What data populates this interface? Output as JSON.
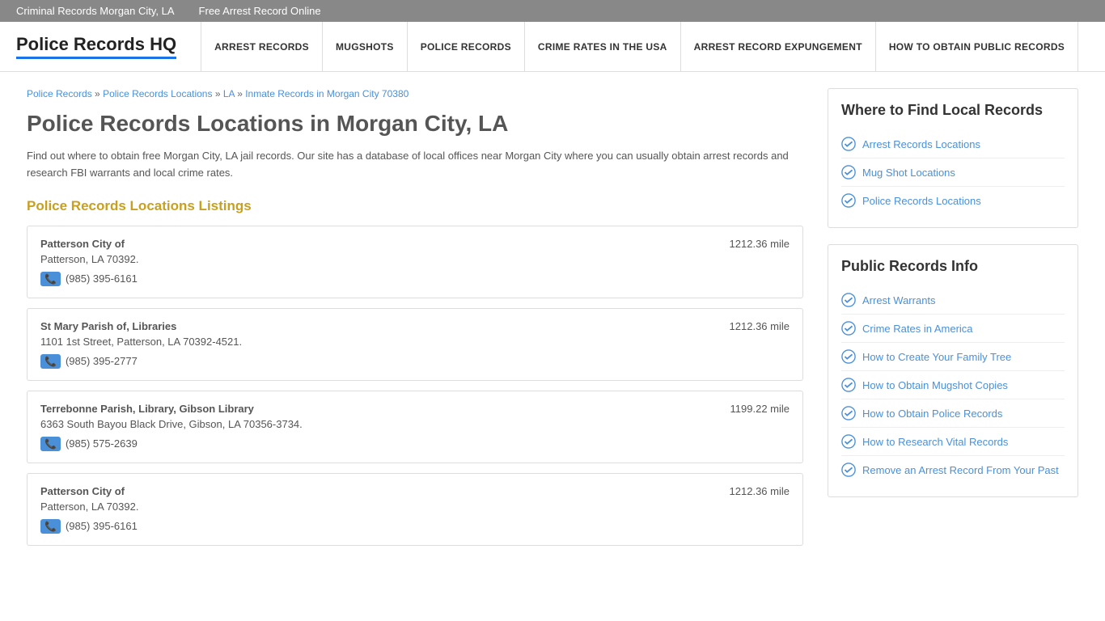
{
  "topbar": {
    "links": [
      {
        "label": "Criminal Records Morgan City, LA",
        "href": "#"
      },
      {
        "label": "Free Arrest Record Online",
        "href": "#"
      }
    ]
  },
  "header": {
    "logo": "Police Records HQ",
    "nav": [
      {
        "label": "ARREST RECORDS"
      },
      {
        "label": "MUGSHOTS"
      },
      {
        "label": "POLICE RECORDS"
      },
      {
        "label": "CRIME RATES IN THE USA"
      },
      {
        "label": "ARREST RECORD EXPUNGEMENT"
      },
      {
        "label": "HOW TO OBTAIN PUBLIC RECORDS"
      }
    ]
  },
  "breadcrumb": {
    "items": [
      {
        "label": "Police Records",
        "href": "#"
      },
      {
        "label": "Police Records Locations",
        "href": "#"
      },
      {
        "label": "LA",
        "href": "#"
      },
      {
        "label": "Inmate Records in Morgan City 70380",
        "href": "#"
      }
    ]
  },
  "page": {
    "title": "Police Records Locations in Morgan City, LA",
    "description": "Find out where to obtain free Morgan City, LA jail records. Our site has a database of local offices near Morgan City where you can usually obtain arrest records and research FBI warrants and local crime rates.",
    "listings_heading": "Police Records Locations Listings"
  },
  "records": [
    {
      "name": "Patterson City of",
      "address": "Patterson, LA 70392.",
      "phone": "(985) 395-6161",
      "distance": "1212.36 mile"
    },
    {
      "name": "St Mary Parish of, Libraries",
      "address": "1101 1st Street, Patterson, LA 70392-4521.",
      "phone": "(985) 395-2777",
      "distance": "1212.36 mile"
    },
    {
      "name": "Terrebonne Parish, Library, Gibson Library",
      "address": "6363 South Bayou Black Drive, Gibson, LA 70356-3734.",
      "phone": "(985) 575-2639",
      "distance": "1199.22 mile"
    },
    {
      "name": "Patterson City of",
      "address": "Patterson, LA 70392.",
      "phone": "(985) 395-6161",
      "distance": "1212.36 mile"
    }
  ],
  "sidebar": {
    "local_records": {
      "title": "Where to Find Local Records",
      "links": [
        {
          "label": "Arrest Records Locations"
        },
        {
          "label": "Mug Shot Locations"
        },
        {
          "label": "Police Records Locations"
        }
      ]
    },
    "public_records": {
      "title": "Public Records Info",
      "links": [
        {
          "label": "Arrest Warrants"
        },
        {
          "label": "Crime Rates in America"
        },
        {
          "label": "How to Create Your Family Tree"
        },
        {
          "label": "How to Obtain Mugshot Copies"
        },
        {
          "label": "How to Obtain Police Records"
        },
        {
          "label": "How to Research Vital Records"
        },
        {
          "label": "Remove an Arrest Record From Your Past"
        }
      ]
    }
  }
}
